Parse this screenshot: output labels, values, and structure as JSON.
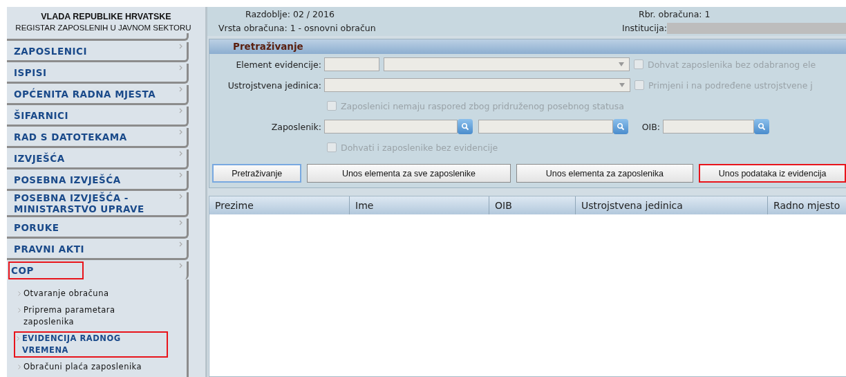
{
  "header": {
    "line1": "VLADA REPUBLIKE HRVATSKE",
    "line2": "REGISTAR ZAPOSLENIH U JAVNOM SEKTORU"
  },
  "sidebar": {
    "items": [
      {
        "label": "ZAPOSLENICI",
        "highlighted": false,
        "expanded": false
      },
      {
        "label": "ISPISI",
        "highlighted": false,
        "expanded": false
      },
      {
        "label": "OPĆENITA RADNA MJESTA",
        "highlighted": false,
        "expanded": false
      },
      {
        "label": "ŠIFARNICI",
        "highlighted": false,
        "expanded": false
      },
      {
        "label": "RAD S DATOTEKAMA",
        "highlighted": false,
        "expanded": false
      },
      {
        "label": "IZVJEŠĆA",
        "highlighted": false,
        "expanded": false
      },
      {
        "label": "POSEBNA IZVJEŠĆA",
        "highlighted": false,
        "expanded": false
      },
      {
        "label": "POSEBNA IZVJEŠĆA - MINISTARSTVO UPRAVE",
        "highlighted": false,
        "expanded": false
      },
      {
        "label": "PORUKE",
        "highlighted": false,
        "expanded": false
      },
      {
        "label": "PRAVNI AKTI",
        "highlighted": false,
        "expanded": false
      },
      {
        "label": "COP",
        "highlighted": true,
        "expanded": true,
        "children": [
          {
            "label": "Otvaranje obračuna",
            "selected": false,
            "highlighted": false
          },
          {
            "label": "Priprema parametara zaposlenika",
            "selected": false,
            "highlighted": false
          },
          {
            "label": "EVIDENCIJA RADNOG VREMENA",
            "selected": true,
            "highlighted": true
          },
          {
            "label": "Obračuni plaća zaposlenika",
            "selected": false,
            "highlighted": false
          }
        ]
      }
    ]
  },
  "info": {
    "period": "Razdoblje: 02 / 2016",
    "type": "Vrsta obračuna: 1 - osnovni obračun",
    "number": "Rbr. obračuna: 1",
    "institution_label": "Institucija: "
  },
  "search_panel": {
    "title": "Pretraživanje",
    "element_label": "Element evidencije:",
    "unit_label": "Ustrojstvena jedinica:",
    "employee_label": "Zaposlenik:",
    "oib_label": "OIB:",
    "checkboxes": [
      {
        "label": "Dohvat zaposlenika bez odabranog ele",
        "checked": false,
        "disabled": true
      },
      {
        "label": "Primjeni i na podređene ustrojstvene j",
        "checked": false,
        "disabled": true
      },
      {
        "label": "Zaposlenici nemaju raspored zbog pridruženog posebnog statusa",
        "checked": false,
        "disabled": true
      },
      {
        "label": "Dohvati i zaposlenike bez evidencije",
        "checked": false,
        "disabled": true
      }
    ],
    "buttons": [
      {
        "label": "Pretraživanje",
        "highlighted": false,
        "focused": true
      },
      {
        "label": "Unos elementa za sve zaposlenike",
        "highlighted": false,
        "focused": false
      },
      {
        "label": "Unos elementa za zaposlenika",
        "highlighted": false,
        "focused": false
      },
      {
        "label": "Unos podataka iz evidencija",
        "highlighted": true,
        "focused": false
      }
    ]
  },
  "table": {
    "columns": [
      "Prezime",
      "Ime",
      "OIB",
      "Ustrojstvena jedinica",
      "Radno mjesto"
    ]
  }
}
